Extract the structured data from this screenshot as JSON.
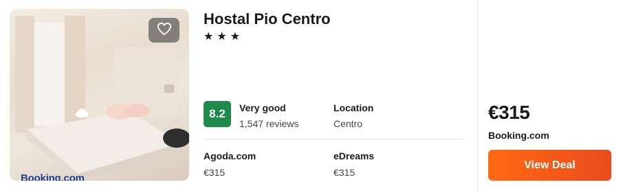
{
  "hotel": {
    "name": "Hostal Pio Centro",
    "stars": "★★★",
    "photo_logo": "Booking.com"
  },
  "rating": {
    "score": "8.2",
    "label": "Very good",
    "reviews": "1,547 reviews"
  },
  "location": {
    "label": "Location",
    "value": "Centro"
  },
  "providers": [
    {
      "name": "Agoda.com",
      "price": "€315"
    },
    {
      "name": "eDreams",
      "price": "€315"
    }
  ],
  "deal": {
    "price": "€315",
    "provider": "Booking.com",
    "button_label": "View Deal"
  },
  "icons": {
    "favorite": "heart-icon"
  },
  "colors": {
    "rating_badge": "#1e8a4c",
    "deal_button": "#ff6a13"
  }
}
